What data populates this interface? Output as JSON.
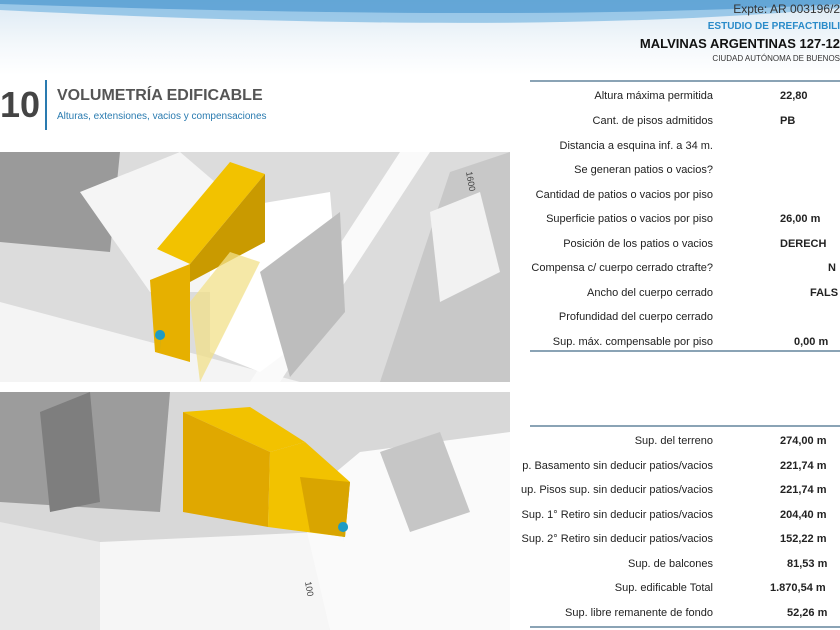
{
  "header": {
    "expte": "Expte: AR 003196/2",
    "estudio": "ESTUDIO DE PREFACTIBILI",
    "address": "MALVINAS ARGENTINAS 127-12",
    "city": "CIUDAD AUTÓNOMA DE BUENOS"
  },
  "section": {
    "number": "10",
    "title": "VOLUMETRÍA EDIFICABLE",
    "subtitle": "Alturas, extensiones, vacios y compensaciones"
  },
  "maps": {
    "street_label_top": "1600",
    "street_label_bottom": "100",
    "highlight_color": "#f2c200",
    "pin_color": "#1e9bc4"
  },
  "table1": [
    {
      "label": "Altura máxima permitida",
      "value": "22,80"
    },
    {
      "label": "Cant. de pisos admitidos",
      "value": "PB"
    },
    {
      "label": "Distancia a esquina inf. a 34 m.",
      "value": ""
    },
    {
      "label": "Se generan patios o vacios?",
      "value": ""
    },
    {
      "label": "Cantidad de patios o vacios por piso",
      "value": ""
    },
    {
      "label": "Superficie patios o vacios por piso",
      "value": "26,00 m"
    },
    {
      "label": "Posición de los patios o vacios",
      "value": "DERECH"
    },
    {
      "label": "Compensa c/ cuerpo cerrado ctrafte?",
      "value": "N"
    },
    {
      "label": "Ancho del cuerpo cerrado",
      "value": "FALS"
    },
    {
      "label": "Profundidad del cuerpo cerrado",
      "value": ""
    },
    {
      "label": "Sup. máx. compensable por piso",
      "value": "0,00 m"
    }
  ],
  "table2": [
    {
      "label": "Sup. del terreno",
      "value": "274,00 m"
    },
    {
      "label": "p. Basamento sin deducir patios/vacios",
      "value": "221,74 m"
    },
    {
      "label": "up. Pisos sup. sin deducir patios/vacios",
      "value": "221,74 m"
    },
    {
      "label": "Sup. 1° Retiro sin deducir patios/vacios",
      "value": "204,40 m"
    },
    {
      "label": "Sup. 2° Retiro sin deducir patios/vacios",
      "value": "152,22 m"
    },
    {
      "label": "Sup. de balcones",
      "value": "81,53 m"
    },
    {
      "label": "Sup. edificable Total",
      "value": "1.870,54 m"
    },
    {
      "label": "Sup. libre remanente de fondo",
      "value": "52,26 m"
    }
  ]
}
